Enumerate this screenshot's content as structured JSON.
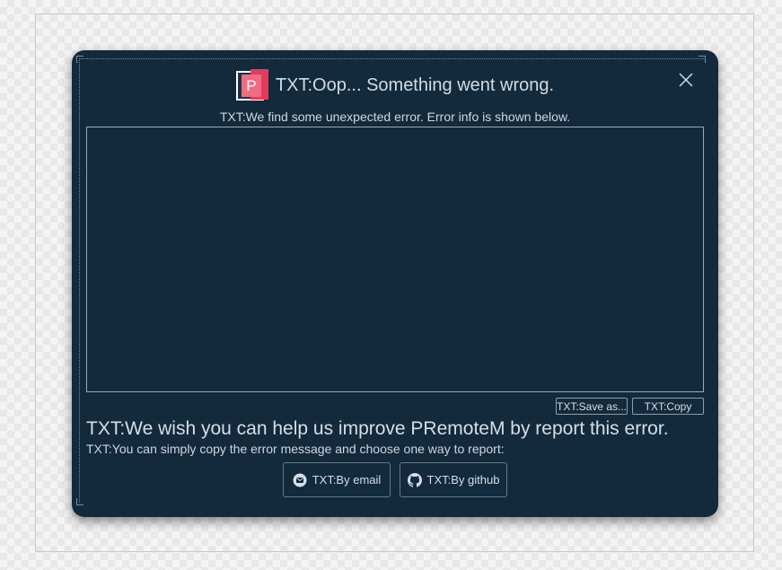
{
  "dialog": {
    "title": "TXT:Oop... Something went wrong.",
    "logo_letter": "P",
    "subtitle": "TXT:We find some unexpected error. Error info is shown below.",
    "error_text": "",
    "save_as_label": "TXT:Save as...",
    "copy_label": "TXT:Copy",
    "help_heading": "TXT:We wish you can help us improve PRemoteM by report this error.",
    "help_sub": "TXT:You can simply copy the error message and choose one way to report:",
    "email_label": "TXT:By email",
    "github_label": "TXT:By github"
  },
  "icons": {
    "logo": "premotem-logo-icon",
    "close": "close-icon",
    "email": "email-icon",
    "github": "github-icon"
  },
  "colors": {
    "dialog_background": "#132a3d",
    "text": "#d7dee5",
    "logo_pink": "#e23c5b",
    "logo_light_pink": "#f06b83"
  }
}
